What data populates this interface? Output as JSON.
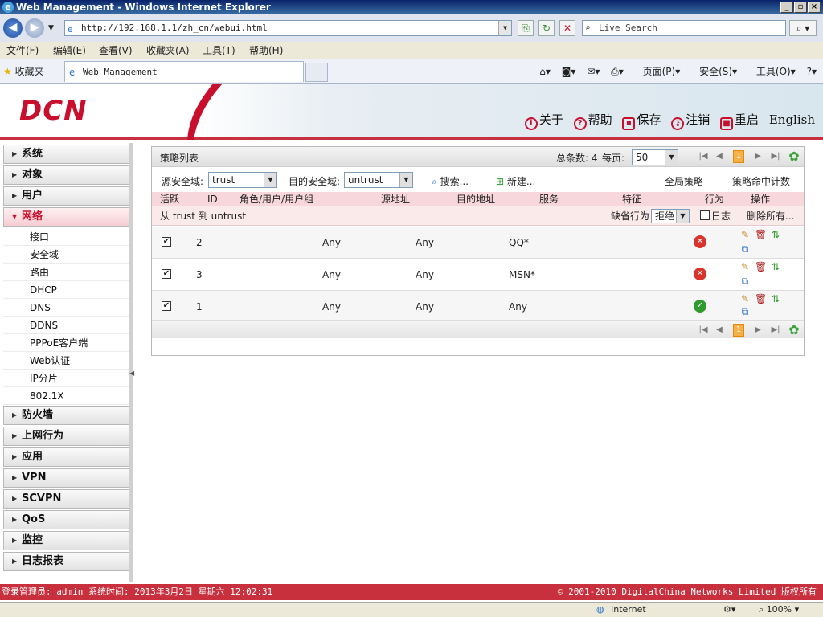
{
  "browser": {
    "title": "Web Management - Windows Internet Explorer",
    "url": "http://192.168.1.1/zh_cn/webui.html",
    "search_placeholder": "Live Search",
    "menu": [
      "文件(F)",
      "编辑(E)",
      "查看(V)",
      "收藏夹(A)",
      "工具(T)",
      "帮助(H)"
    ],
    "favorites_label": "收藏夹",
    "tab_title": "Web Management",
    "commands": [
      "页面(P)",
      "安全(S)",
      "工具(O)"
    ],
    "status_zone": "Internet",
    "zoom": "100%"
  },
  "header": {
    "logo": "DCN",
    "links": [
      "关于",
      "帮助",
      "保存",
      "注销",
      "重启"
    ],
    "language": "English"
  },
  "sidebar": {
    "groups_top": [
      "系统",
      "对象",
      "用户",
      "网络"
    ],
    "network_items": [
      "接口",
      "安全域",
      "路由",
      "DHCP",
      "DNS",
      "DDNS",
      "PPPoE客户端",
      "Web认证",
      "IP分片",
      "802.1X"
    ],
    "groups_bottom": [
      "防火墙",
      "上网行为",
      "应用",
      "VPN",
      "SCVPN",
      "QoS",
      "监控",
      "日志报表"
    ]
  },
  "panel": {
    "title": "策略列表",
    "total_label": "总条数: 4",
    "per_page_label": "每页:",
    "per_page_value": "50",
    "current_page": "1",
    "src_zone_label": "源安全域:",
    "src_zone_value": "trust",
    "dst_zone_label": "目的安全域:",
    "dst_zone_value": "untrust",
    "search_label": "搜索...",
    "new_label": "新建...",
    "global_policy_label": "全局策略",
    "hit_counter_label": "策略命中计数",
    "columns": [
      "活跃",
      "ID",
      "角色/用户/用户组",
      "源地址",
      "目的地址",
      "服务",
      "特征",
      "行为",
      "操作"
    ],
    "zone_row": {
      "text": "从 trust 到 untrust",
      "default_action_label": "缺省行为",
      "default_action_value": "拒绝",
      "log_label": "日志",
      "delete_all_label": "删除所有..."
    },
    "rows": [
      {
        "id": "2",
        "src": "Any",
        "dst": "Any",
        "service": "QQ*",
        "action": "deny"
      },
      {
        "id": "3",
        "src": "Any",
        "dst": "Any",
        "service": "MSN*",
        "action": "deny"
      },
      {
        "id": "1",
        "src": "Any",
        "dst": "Any",
        "service": "Any",
        "action": "permit"
      }
    ]
  },
  "status": {
    "left": "登录管理员: admin 系统时间: 2013年3月2日 星期六 12:02:31",
    "right": "© 2001-2010 DigitalChina Networks Limited 版权所有"
  },
  "colors": {
    "brand_red": "#c8102e",
    "header_pink": "#f7d7dc",
    "deny": "#d9342b",
    "permit": "#2e9b2e"
  }
}
